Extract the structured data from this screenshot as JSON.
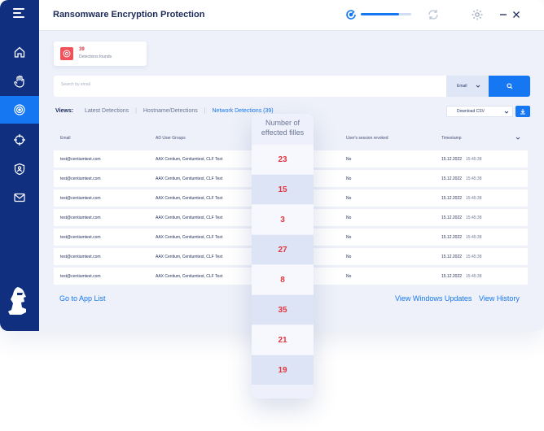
{
  "app": {
    "title": "Ransomware Encryption Protection",
    "scan_progress": 0.75
  },
  "sidebar": {
    "items": [
      {
        "name": "home",
        "icon": "home-icon"
      },
      {
        "name": "hand",
        "icon": "hand-icon"
      },
      {
        "name": "protection",
        "icon": "radar-icon",
        "active": true
      },
      {
        "name": "target",
        "icon": "crosshair-icon"
      },
      {
        "name": "shield",
        "icon": "user-shield-icon"
      },
      {
        "name": "mail",
        "icon": "mail-icon"
      }
    ]
  },
  "detections": {
    "count": "39",
    "label": "Detections founds"
  },
  "search": {
    "placeholder": "Search by email",
    "select_value": "Email"
  },
  "views": {
    "label": "Views:",
    "links": [
      "Latest Detections",
      "Hostname/Detections",
      "Network Detections (39)"
    ]
  },
  "export": {
    "label": "Download CSV"
  },
  "table": {
    "headers": [
      "Email",
      "AD User Groups",
      "User's session revoked",
      "Timestamp"
    ],
    "rows": [
      {
        "email": "test@centiumtest.com",
        "groups": "AAX Centium, Centiumtest, CLF Test",
        "revoked": "No",
        "date": "15.12.2022",
        "time": "15:45:38"
      },
      {
        "email": "test@centiumtest.com",
        "groups": "AAX Centium, Centiumtest, CLF Test",
        "revoked": "No",
        "date": "15.12.2022",
        "time": "15:45:38"
      },
      {
        "email": "test@centiumtest.com",
        "groups": "AAX Centium, Centiumtest, CLF Test",
        "revoked": "No",
        "date": "15.12.2022",
        "time": "15:45:38"
      },
      {
        "email": "test@centiumtest.com",
        "groups": "AAX Centium, Centiumtest, CLF Test",
        "revoked": "No",
        "date": "15.12.2022",
        "time": "15:45:38"
      },
      {
        "email": "test@centiumtest.com",
        "groups": "AAX Centium, Centiumtest, CLF Test",
        "revoked": "No",
        "date": "15.12.2022",
        "time": "15:45:38"
      },
      {
        "email": "test@centiumtest.com",
        "groups": "AAX Centium, Centiumtest, CLF Test",
        "revoked": "No",
        "date": "15.12.2022",
        "time": "15:45:38"
      },
      {
        "email": "test@centiumtest.com",
        "groups": "AAX Centium, Centiumtest, CLF Test",
        "revoked": "No",
        "date": "15.12.2022",
        "time": "15:45:38"
      }
    ]
  },
  "footer": {
    "app_list": "Go to App List",
    "windows_updates": "View Windows Updates",
    "history": "View History"
  },
  "effected_files": {
    "header": "Number of effected filles",
    "values": [
      "23",
      "15",
      "3",
      "27",
      "8",
      "35",
      "21",
      "19"
    ]
  },
  "colors": {
    "sidebar": "#10307f",
    "accent": "#1677f2",
    "alert": "#e0353f"
  }
}
